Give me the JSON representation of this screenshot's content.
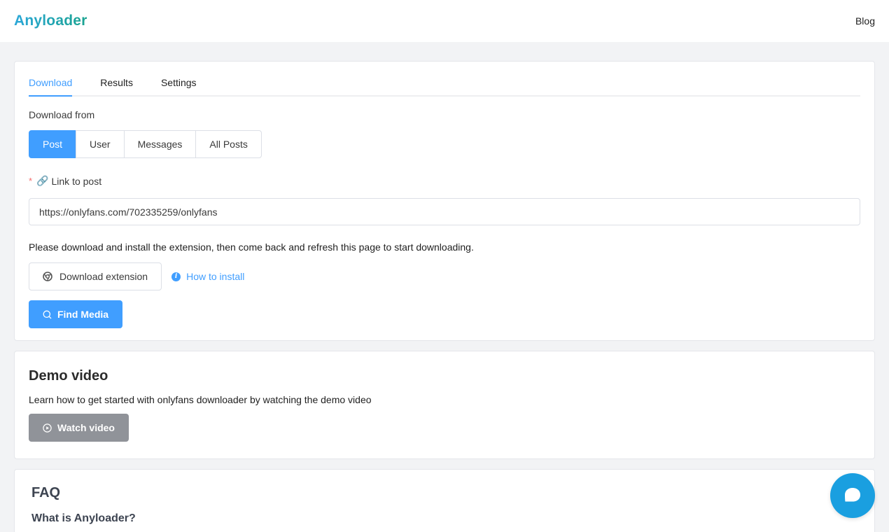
{
  "header": {
    "logo": "Anyloader",
    "blog": "Blog"
  },
  "tabs": [
    {
      "label": "Download",
      "active": true
    },
    {
      "label": "Results",
      "active": false
    },
    {
      "label": "Settings",
      "active": false
    }
  ],
  "download_from": {
    "label": "Download from",
    "options": [
      {
        "label": "Post",
        "active": true
      },
      {
        "label": "User",
        "active": false
      },
      {
        "label": "Messages",
        "active": false
      },
      {
        "label": "All Posts",
        "active": false
      }
    ]
  },
  "link_field": {
    "required_mark": "*",
    "icon": "link-icon",
    "label": "Link to post",
    "value": "https://onlyfans.com/702335259/onlyfans"
  },
  "extension": {
    "note": "Please download and install the extension, then come back and refresh this page to start downloading.",
    "download_button": "Download extension",
    "how_to_install": "How to install"
  },
  "find_button": "Find Media",
  "demo": {
    "title": "Demo video",
    "description": "Learn how to get started with onlyfans downloader by watching the demo video",
    "button": "Watch video"
  },
  "faq": {
    "title": "FAQ",
    "first_question": "What is Anyloader?"
  },
  "colors": {
    "primary": "#409eff",
    "disabled_button": "#909399",
    "chat": "#1a9fe0"
  }
}
